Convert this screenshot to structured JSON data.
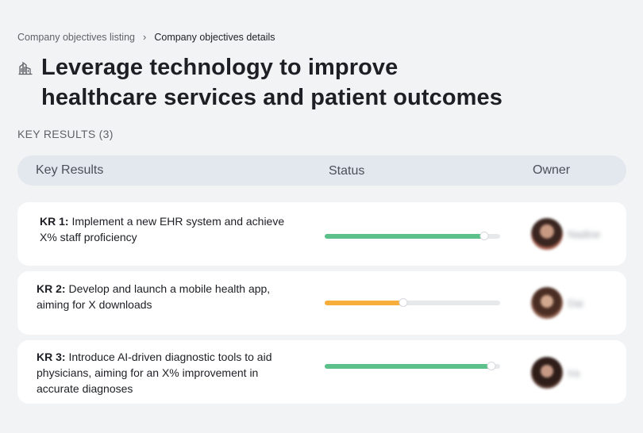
{
  "breadcrumb": {
    "parent": "Company objectives listing",
    "separator": "›",
    "current": "Company objectives details"
  },
  "objective": {
    "icon": "bank-building-icon",
    "title": "Leverage technology to improve healthcare services and patient outcomes"
  },
  "key_results_count_label": "KEY RESULTS (3)",
  "table": {
    "columns": [
      "Key Results",
      "Status",
      "Owner"
    ],
    "rows": [
      {
        "kr_label": "KR 1:",
        "text": "Implement a new EHR system and achieve X% staff proficiency",
        "progress": 0.91,
        "status_color": "#5cc08a",
        "owner": {
          "name": "Nadine"
        }
      },
      {
        "kr_label": "KR 2:",
        "text": "Develop and launch a mobile health app, aiming for X downloads",
        "progress": 0.45,
        "status_color": "#f6ad3b",
        "owner": {
          "name": "Dai"
        }
      },
      {
        "kr_label": "KR 3:",
        "text": "Introduce AI-driven diagnostic tools to aid physicians, aiming for an X% improvement in accurate diagnoses",
        "progress": 0.95,
        "status_color": "#5cc08a",
        "owner": {
          "name": "Ira"
        }
      }
    ]
  },
  "colors": {
    "background": "#f2f3f5",
    "header_bg": "#e3e7ee",
    "card_bg": "#ffffff",
    "green": "#5cc08a",
    "orange": "#f6ad3b"
  }
}
